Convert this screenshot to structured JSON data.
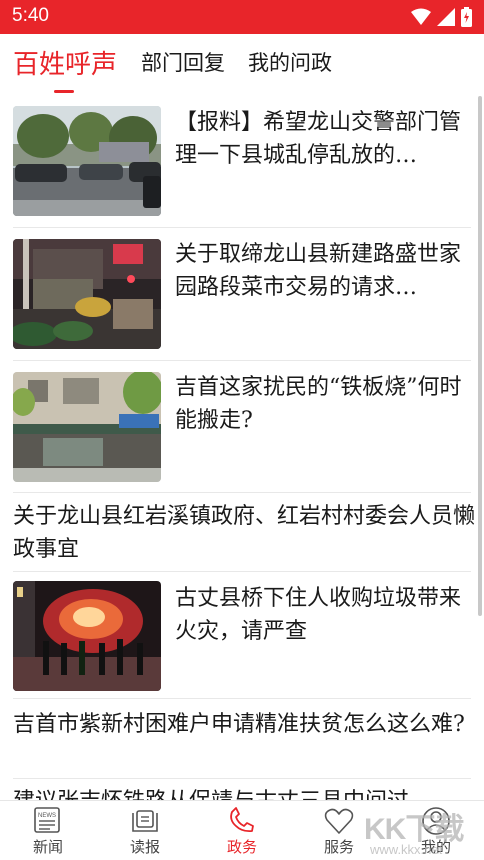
{
  "status": {
    "time": "5:40"
  },
  "tabs": [
    {
      "label": "百姓呼声",
      "active": true
    },
    {
      "label": "部门回复",
      "active": false
    },
    {
      "label": "我的问政",
      "active": false
    }
  ],
  "items": [
    {
      "title": "【报料】希望龙山交警部门管理一下县城乱停乱放的…",
      "image": "street-cars-photo"
    },
    {
      "title": "关于取缔龙山县新建路盛世家园路段菜市交易的请求…",
      "image": "night-market-photo"
    },
    {
      "title": "吉首这家扰民的“铁板烧”何时能搬走?",
      "image": "building-shops-photo"
    },
    {
      "title": "关于龙山县红岩溪镇政府、红岩村村委会人员懒政事宜",
      "image": null
    },
    {
      "title": "古丈县桥下住人收购垃圾带来火灾，请严查",
      "image": "fire-night-photo"
    },
    {
      "title": "吉首市紫新村困难户申请精准扶贫怎么这么难?",
      "image": null
    },
    {
      "title": "建议张吉怀铁路从保靖与古丈三县中间过",
      "image": null
    }
  ],
  "nav": [
    {
      "label": "新闻",
      "icon": "newspaper-icon",
      "active": false
    },
    {
      "label": "读报",
      "icon": "book-icon",
      "active": false
    },
    {
      "label": "政务",
      "icon": "government-icon",
      "active": true
    },
    {
      "label": "服务",
      "icon": "heart-icon",
      "active": false
    },
    {
      "label": "我的",
      "icon": "person-icon",
      "active": false
    }
  ],
  "watermark": {
    "brand": "KK下载",
    "url": "www.kkx.net"
  },
  "colors": {
    "accent": "#e8252a"
  }
}
